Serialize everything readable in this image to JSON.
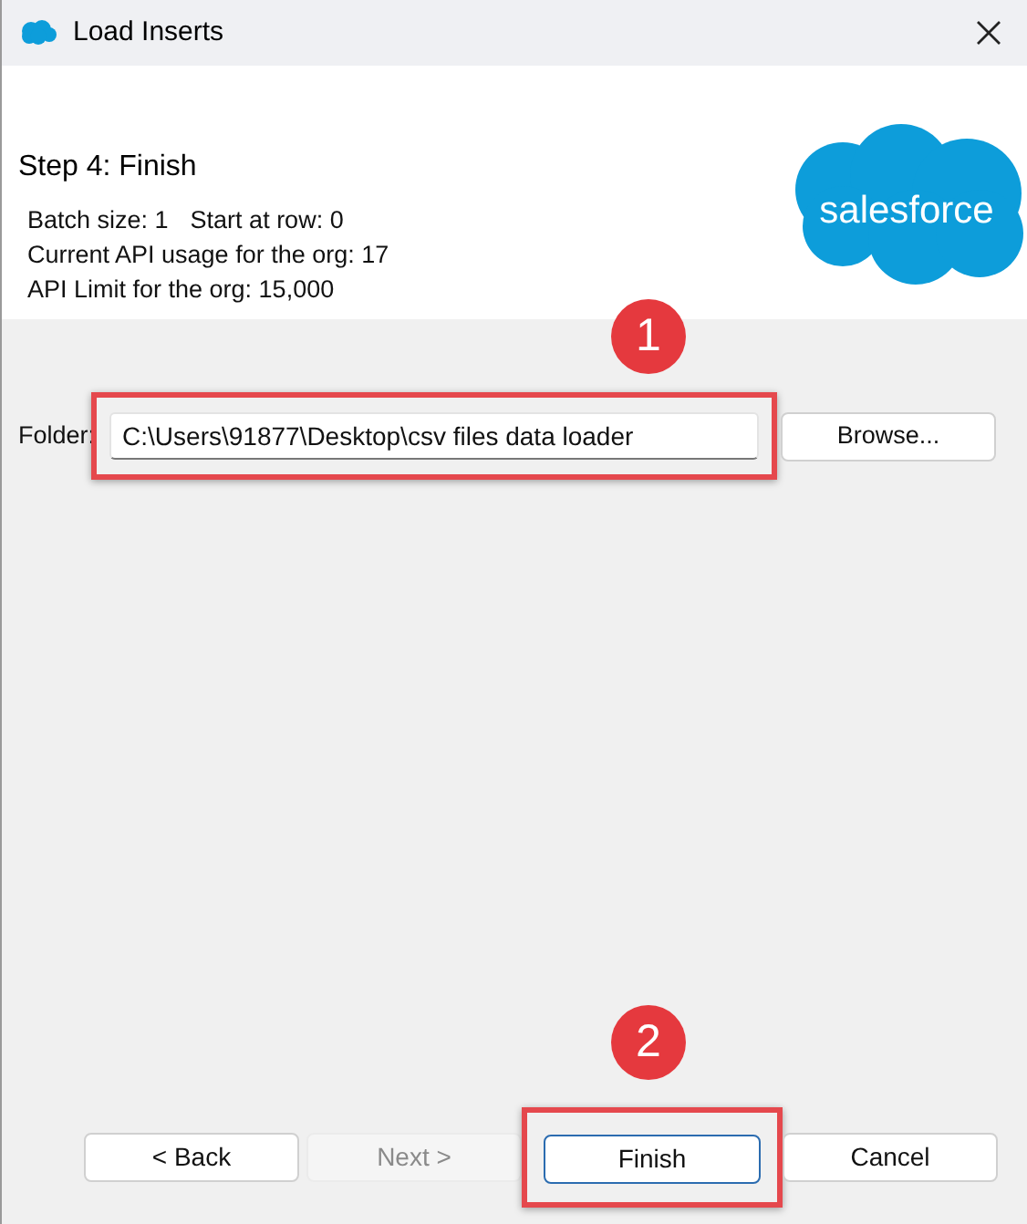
{
  "window": {
    "title": "Load Inserts"
  },
  "header": {
    "step_title": "Step 4: Finish",
    "logo_text": "salesforce",
    "info_lines": [
      [
        "Batch size: 1",
        "Start at row: 0"
      ],
      [
        "Current API usage for the org: 17"
      ],
      [
        "API Limit for the org: 15,000"
      ]
    ]
  },
  "folder": {
    "label": "Folder:",
    "value": "C:\\Users\\91877\\Desktop\\csv files data loader",
    "browse": "Browse..."
  },
  "buttons": [
    {
      "label": "< Back",
      "disabled": false,
      "default": false,
      "highlighted": false
    },
    {
      "label": "Next >",
      "disabled": true,
      "default": false,
      "highlighted": false
    },
    {
      "label": "Finish",
      "disabled": false,
      "default": true,
      "highlighted": true
    },
    {
      "label": "Cancel",
      "disabled": false,
      "default": false,
      "highlighted": false
    }
  ],
  "folder_highlighted": true,
  "annotations": [
    {
      "label": "1"
    },
    {
      "label": "2"
    }
  ]
}
